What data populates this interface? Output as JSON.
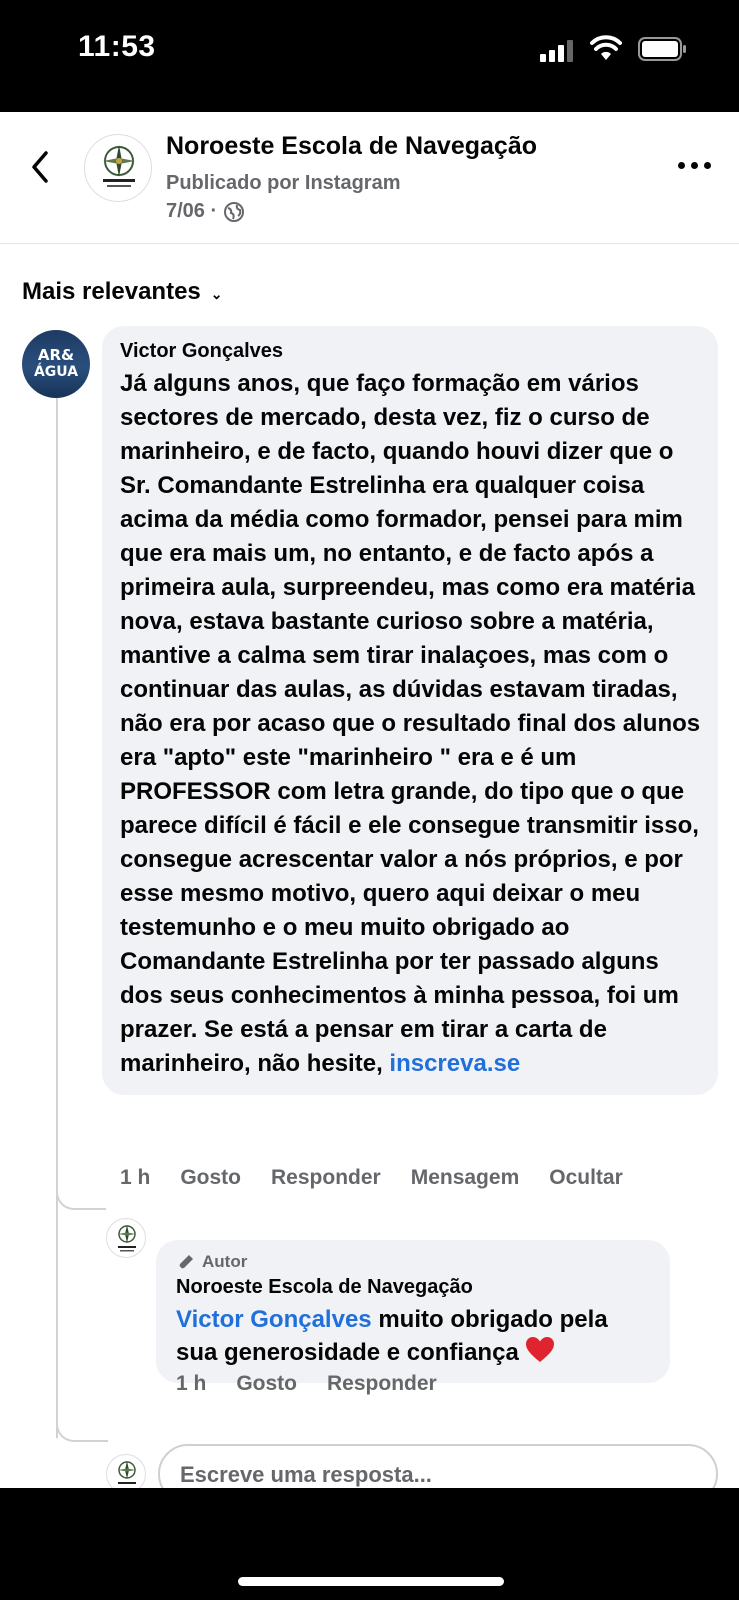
{
  "status_bar": {
    "time": "11:53"
  },
  "header": {
    "page_name": "Noroeste Escola de Navegação",
    "subtitle": "Publicado por Instagram",
    "date": "7/06 ·"
  },
  "comments": {
    "sort_label": "Mais relevantes",
    "main": {
      "author": "Victor Gonçalves",
      "avatar_text_top": "AR&",
      "avatar_text_bottom": "ÁGUA",
      "text": "Já alguns anos, que faço formação em vários sectores de mercado, desta vez, fiz o curso de marinheiro, e de facto, quando houvi dizer que o Sr. Comandante Estrelinha era qualquer coisa acima da média como formador, pensei para mim que era mais um, no entanto, e de facto após a primeira aula, surpreendeu, mas como era matéria nova, estava bastante curioso sobre a matéria, mantive a calma sem tirar inalaçoes, mas com o continuar das aulas,  as dúvidas estavam tiradas, não era por acaso que o resultado final dos alunos era \"apto\" este \"marinheiro \" era e é um PROFESSOR com letra grande, do tipo que o que parece difícil é fácil e ele consegue transmitir isso, consegue acrescentar valor a nós próprios, e por esse mesmo motivo, quero aqui deixar o meu testemunho e o meu muito obrigado ao Comandante Estrelinha por ter passado alguns dos seus conhecimentos  à  minha pessoa, foi um prazer. Se está a pensar em tirar a carta de marinheiro, não hesite,",
      "link": "inscreva.se",
      "time": "1 h",
      "like": "Gosto",
      "reply": "Responder",
      "message": "Mensagem",
      "hide": "Ocultar"
    },
    "reply": {
      "badge": "Autor",
      "author": "Noroeste Escola de Navegação",
      "mention": "Victor Gonçalves",
      "text": " muito obrigado pela sua generosidade e confiança ",
      "time": "1 h",
      "like": "Gosto",
      "reply": "Responder"
    },
    "compose_placeholder": "Escreve uma resposta..."
  },
  "colors": {
    "link": "#216fdb",
    "bubble": "#f0f2f5",
    "muted": "#65676b",
    "heart": "#e0242f"
  },
  "icons": [
    "back-chevron-icon",
    "globe-icon",
    "more-dots-icon",
    "chevron-down-icon",
    "pencil-icon",
    "heart-icon",
    "compass-logo-icon"
  ]
}
